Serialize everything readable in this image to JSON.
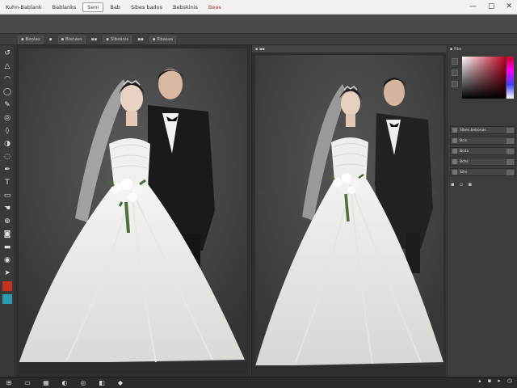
{
  "menubar": {
    "items": [
      {
        "label": "Kuhn-Bablank",
        "style": "normal"
      },
      {
        "label": "Bablanks",
        "style": "normal"
      },
      {
        "label": "Seni",
        "style": "selected"
      },
      {
        "label": "Bab",
        "style": "normal"
      },
      {
        "label": "Sibes bados",
        "style": "normal"
      },
      {
        "label": "Bebskinis",
        "style": "normal"
      },
      {
        "label": "Beas",
        "style": "red"
      }
    ],
    "window_controls": [
      "—",
      "▢",
      "✕"
    ]
  },
  "options_bar": {
    "items": [
      {
        "label": "▪ Beolas",
        "boxed": true
      },
      {
        "label": "▪",
        "boxed": false
      },
      {
        "label": "▪ Bisnass",
        "boxed": true
      },
      {
        "label": "▪▪",
        "boxed": false
      },
      {
        "label": "▪ Sibesnis",
        "boxed": true
      },
      {
        "label": "▪▪",
        "boxed": false
      },
      {
        "label": "▪ Rbasas",
        "boxed": true
      }
    ]
  },
  "toolbox": {
    "tools": [
      {
        "name": "history-icon",
        "glyph": "↺"
      },
      {
        "name": "triangle-tool-icon",
        "glyph": "△"
      },
      {
        "name": "lasso-tool-icon",
        "glyph": "◠"
      },
      {
        "name": "ellipse-tool-icon",
        "glyph": "◯"
      },
      {
        "name": "brush-tool-icon",
        "glyph": "✎"
      },
      {
        "name": "stamp-tool-icon",
        "glyph": "◎"
      },
      {
        "name": "drop-tool-icon",
        "glyph": "◊"
      },
      {
        "name": "paint-tool-icon",
        "glyph": "◑"
      },
      {
        "name": "dodge-tool-icon",
        "glyph": "◌"
      },
      {
        "name": "pen-tool-icon",
        "glyph": "✒"
      },
      {
        "name": "text-tool-icon",
        "glyph": "T"
      },
      {
        "name": "shape-tool-icon",
        "glyph": "▭"
      },
      {
        "name": "hand-tool-icon",
        "glyph": "☚"
      },
      {
        "name": "zoom-tool-icon",
        "glyph": "⊕"
      },
      {
        "name": "quickmask-icon",
        "glyph": "◙"
      },
      {
        "name": "screen-mode-icon",
        "glyph": "▬"
      },
      {
        "name": "eye-tool-icon",
        "glyph": "◉"
      },
      {
        "name": "arrow-tool-icon",
        "glyph": "➤"
      }
    ],
    "foreground_color": "#c83020",
    "accent_color": "#2a9bb0"
  },
  "document_left": {
    "tab_label": ""
  },
  "document_right": {
    "tab_label": "▪ ▪▪"
  },
  "panel": {
    "header": "▪ Rbs",
    "layers": [
      {
        "label": "Sibes bebonas"
      },
      {
        "label": "Bcis"
      },
      {
        "label": "Bcda"
      },
      {
        "label": "Bchs"
      },
      {
        "label": "Sihs"
      }
    ],
    "footer_icons": [
      "▪",
      "▫",
      "▪"
    ]
  },
  "taskbar": {
    "items": [
      {
        "name": "start-icon",
        "glyph": "⊞"
      },
      {
        "name": "file-explorer-icon",
        "glyph": "▭"
      },
      {
        "name": "gallery-icon",
        "glyph": "▦"
      },
      {
        "name": "browser-icon",
        "glyph": "◐"
      },
      {
        "name": "settings-icon",
        "glyph": "◎"
      },
      {
        "name": "photo-app-icon",
        "glyph": "◧"
      },
      {
        "name": "orange-app-icon",
        "glyph": "◆"
      }
    ],
    "tray": [
      "▴",
      "▪",
      "▸",
      "◷"
    ]
  }
}
